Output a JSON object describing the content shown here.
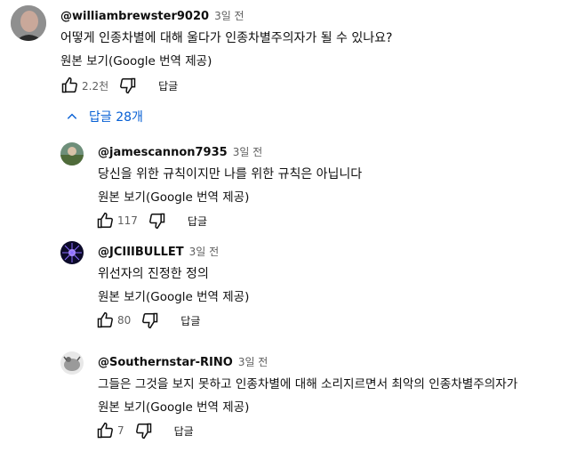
{
  "main_comment": {
    "handle": "@williambrewster9020",
    "time": "3일 전",
    "text": "어떻게 인종차별에 대해 울다가 인종차별주의자가 될 수 있나요?",
    "translate": "원본 보기(Google 번역 제공)",
    "likes": "2.2천",
    "reply_label": "답글"
  },
  "replies_toggle": {
    "label": "답글 28개",
    "icon": "chevron-up-icon",
    "color": "#065fd4"
  },
  "replies": [
    {
      "handle": "@jamescannon7935",
      "time": "3일 전",
      "text": "당신을 위한 규칙이지만 나를 위한 규칙은 아닙니다",
      "translate": "원본 보기(Google 번역 제공)",
      "likes": "117",
      "reply_label": "답글"
    },
    {
      "handle": "@JCIIIBULLET",
      "time": "3일 전",
      "text": "위선자의 진정한 정의",
      "translate": "원본 보기(Google 번역 제공)",
      "likes": "80",
      "reply_label": "답글"
    },
    {
      "handle": "@Southernstar-RINO",
      "time": "3일 전",
      "text": "그들은 그것을 보지 못하고 인종차별에 대해 소리지르면서 최악의 인종차별주의자가",
      "translate": "원본 보기(Google 번역 제공)",
      "likes": "7",
      "reply_label": "답글"
    }
  ]
}
